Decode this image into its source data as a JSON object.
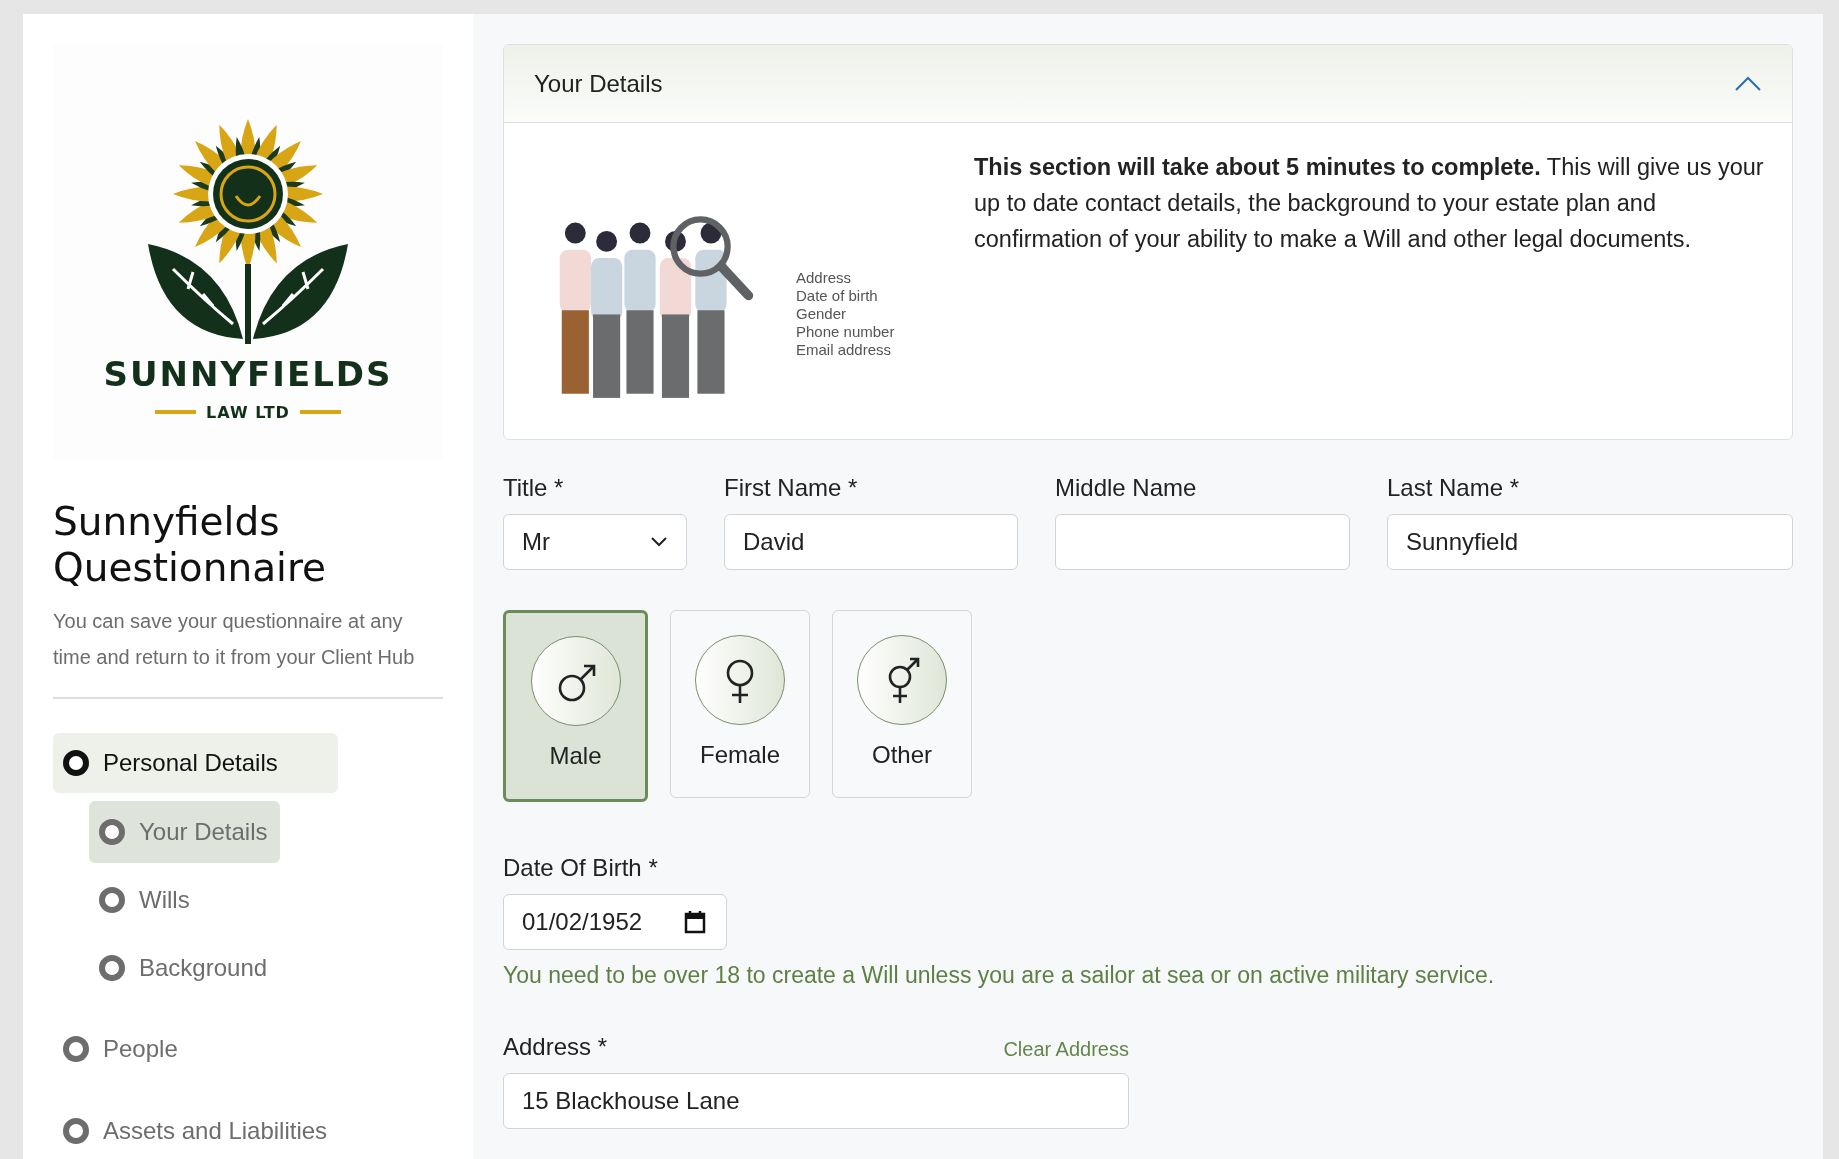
{
  "sidebar": {
    "logo": {
      "name": "SUNNYFIELDS",
      "tagline": "LAW LTD"
    },
    "title": "Sunnyfields Questionnaire",
    "subtitle": "You can save your questionnaire at any time and return to it from your Client Hub",
    "nav": [
      {
        "label": "Personal Details",
        "selected": true,
        "expanded": true,
        "children": [
          {
            "label": "Your Details",
            "selected": true
          },
          {
            "label": "Wills",
            "selected": false
          },
          {
            "label": "Background",
            "selected": false
          }
        ]
      },
      {
        "label": "People",
        "selected": false
      },
      {
        "label": "Assets and Liabilities",
        "selected": false
      }
    ]
  },
  "section": {
    "title": "Your Details",
    "expanded": true,
    "illustration_list": [
      "Address",
      "Date of birth",
      "Gender",
      "Phone number",
      "Email address"
    ],
    "intro": "**This section will take about 5 minutes to complete.**  This will give us your up to date contact details, the background to your estate plan and confirmation of your ability to make a Will and other legal documents."
  },
  "name_fields": [
    {
      "kind": "select",
      "label": "Title *",
      "value": "Mr"
    },
    {
      "kind": "text",
      "label": "First Name *",
      "value": "David"
    },
    {
      "kind": "text",
      "label": "Middle Name"
    },
    {
      "kind": "text",
      "label": "Last Name *",
      "value": "Sunnyfield"
    }
  ],
  "gender_options": [
    {
      "kind": "male",
      "label": "Male",
      "selected": true
    },
    {
      "kind": "female",
      "label": "Female",
      "selected": false
    },
    {
      "kind": "other",
      "label": "Other",
      "selected": false
    }
  ],
  "date_of_birth": {
    "label": "Date Of Birth *",
    "value": "01/02/1952",
    "hint": "You need to be over 18 to create a Will unless you are a sailor at sea or on active military service."
  },
  "address": {
    "label": "Address *",
    "clear_link": "Clear Address",
    "value": "15 Blackhouse Lane"
  }
}
